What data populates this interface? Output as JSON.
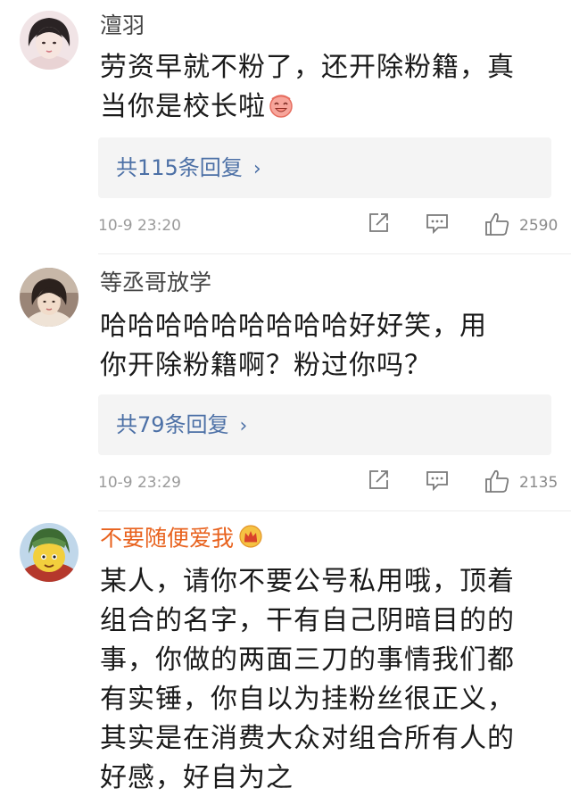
{
  "comments": [
    {
      "username": "澶羽",
      "body_lines": [
        "劳资早就不粉了，还开除粉籍，真",
        "当你是校长啦"
      ],
      "reply_link": "共115条回复",
      "timestamp": "10-9 23:20",
      "likes": "2590"
    },
    {
      "username": "等丞哥放学",
      "body_lines": [
        "哈哈哈哈哈哈哈哈哈好好笑，用",
        "你开除粉籍啊？粉过你吗？"
      ],
      "reply_link": "共79条回复",
      "timestamp": "10-9 23:29",
      "likes": "2135"
    },
    {
      "username": "不要随便爱我",
      "body_lines": [
        "某人，请你不要公号私用哦，顶着",
        "组合的名字，干有自己阴暗目的的",
        "事，你做的两面三刀的事情我们都",
        "有实锤，你自以为挂粉丝很正义，",
        "其实是在消费大众对组合所有人的",
        "好感，好自为之"
      ]
    }
  ],
  "colors": {
    "username": "#444444",
    "vip_username": "#e8621e",
    "reply_link": "#4c70a6",
    "reply_bg": "#f4f4f4",
    "meta_text": "#9a9a9a"
  },
  "icons": {
    "reply_chevron": "›",
    "repost": "share-square-icon",
    "comment": "comment-bubble-icon",
    "like": "thumbs-up-icon"
  }
}
